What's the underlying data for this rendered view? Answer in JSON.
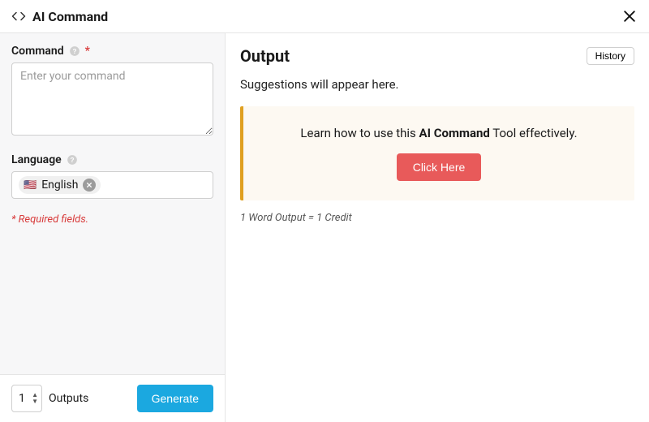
{
  "header": {
    "title": "AI Command"
  },
  "form": {
    "command_label": "Command",
    "command_placeholder": "Enter your command",
    "language_label": "Language",
    "language_chip": "English",
    "language_flag": "🇺🇸",
    "required_note": "* Required fields."
  },
  "footer": {
    "outputs_value": "1",
    "outputs_label": "Outputs",
    "generate": "Generate"
  },
  "main": {
    "output_title": "Output",
    "history": "History",
    "placeholder": "Suggestions will appear here.",
    "tip_prefix": "Learn how to use this ",
    "tip_bold": "AI Command",
    "tip_suffix": " Tool effectively.",
    "click_here": "Click Here",
    "credit_note": "1 Word Output = 1 Credit"
  }
}
